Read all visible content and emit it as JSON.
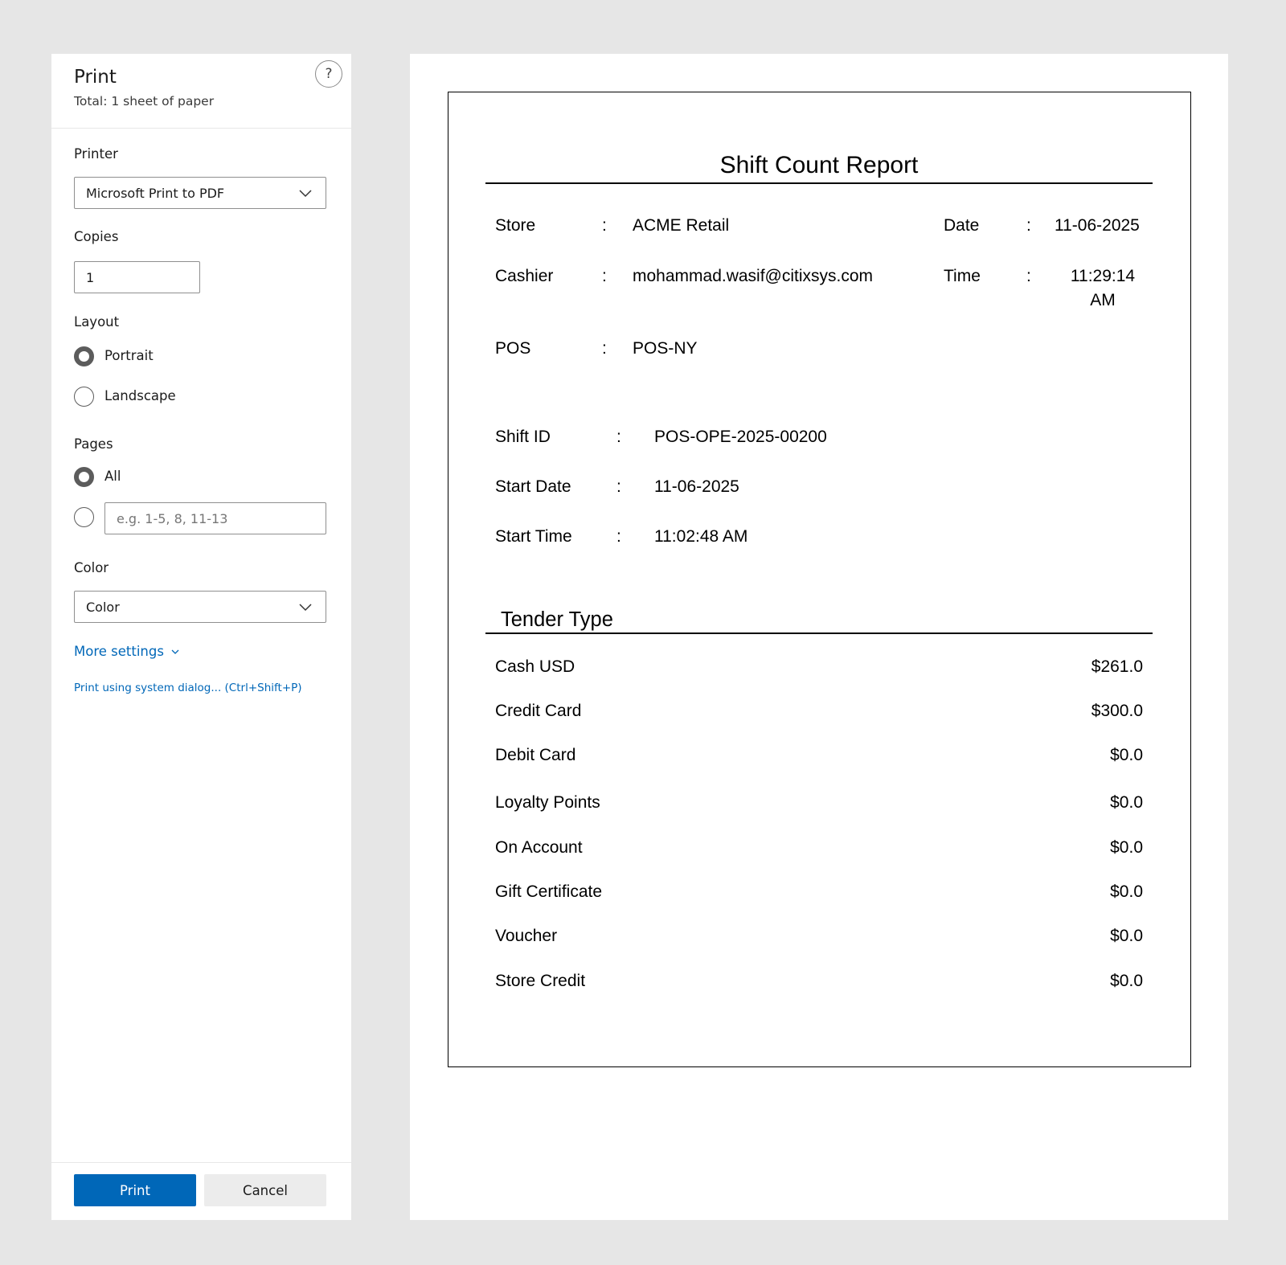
{
  "dialog": {
    "title": "Print",
    "subtitle": "Total: 1 sheet of paper",
    "help_glyph": "?",
    "printer": {
      "label": "Printer",
      "selected": "Microsoft Print to PDF"
    },
    "copies": {
      "label": "Copies",
      "value": "1"
    },
    "layout": {
      "label": "Layout",
      "options": [
        "Portrait",
        "Landscape"
      ],
      "selected": "Portrait"
    },
    "pages": {
      "label": "Pages",
      "all_label": "All",
      "custom_placeholder": "e.g. 1-5, 8, 11-13",
      "selected": "All"
    },
    "color": {
      "label": "Color",
      "selected": "Color"
    },
    "more_settings": "More settings",
    "system_dialog": "Print using system dialog... (Ctrl+Shift+P)",
    "print_button": "Print",
    "cancel_button": "Cancel",
    "accent_color": "#0067b8"
  },
  "report": {
    "title": "Shift Count Report",
    "colon": ":",
    "store": {
      "label": "Store",
      "value": "ACME Retail"
    },
    "cashier": {
      "label": "Cashier",
      "value": "mohammad.wasif@citixsys.com"
    },
    "pos": {
      "label": "POS",
      "value": "POS-NY"
    },
    "date": {
      "label": "Date",
      "value": "11-06-2025"
    },
    "time": {
      "label": "Time",
      "value_line1": "11:29:14",
      "value_line2": "AM"
    },
    "shift_id": {
      "label": "Shift ID",
      "value": "POS-OPE-2025-00200"
    },
    "start_date": {
      "label": "Start Date",
      "value": "11-06-2025"
    },
    "start_time": {
      "label": "Start Time",
      "value": "11:02:48 AM"
    },
    "tender_heading": "Tender Type",
    "tenders": [
      {
        "name": "Cash USD",
        "amount": "$261.0"
      },
      {
        "name": "Credit Card",
        "amount": "$300.0"
      },
      {
        "name": "Debit Card",
        "amount": "$0.0"
      },
      {
        "name": "Loyalty Points",
        "amount": "$0.0"
      },
      {
        "name": "On Account",
        "amount": "$0.0"
      },
      {
        "name": "Gift Certificate",
        "amount": "$0.0"
      },
      {
        "name": "Voucher",
        "amount": "$0.0"
      },
      {
        "name": "Store Credit",
        "amount": "$0.0"
      }
    ]
  }
}
